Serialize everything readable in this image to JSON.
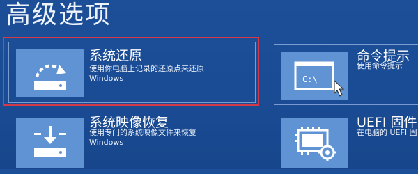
{
  "page": {
    "title": "高级选项"
  },
  "tiles": [
    {
      "title": "系统还原",
      "desc1": "使用你电脑上记录的还原点来还原",
      "desc2": "Windows",
      "icon": "restore-icon"
    },
    {
      "title": "命令提示",
      "desc1": "使用命令提示",
      "desc2": "",
      "icon": "command-prompt-icon",
      "icon_text": "C:\\"
    },
    {
      "title": "系统映像恢复",
      "desc1": "使用专门的系统映像文件来恢复",
      "desc2": "Windows",
      "icon": "system-image-icon"
    },
    {
      "title": "UEFI 固件",
      "desc1": "在电脑的 UEFI 固",
      "desc2": "",
      "icon": "firmware-settings-icon"
    }
  ],
  "colors": {
    "background": "#1b4f9a",
    "icon_box": "#5f93d3",
    "highlight": "#d23a48"
  }
}
